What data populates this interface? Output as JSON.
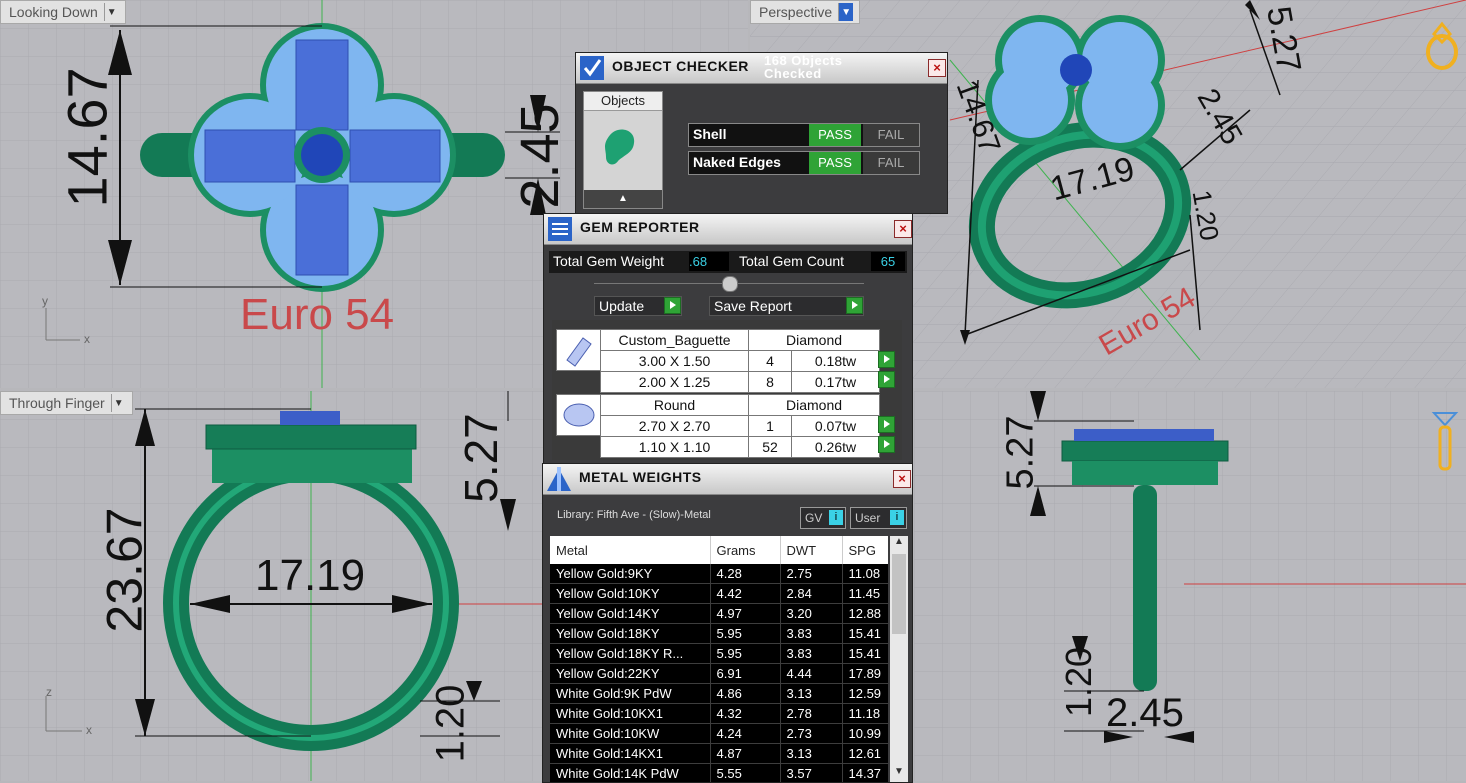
{
  "viewports": {
    "top": {
      "label": "Looking Down",
      "dims": [
        "14.67",
        "2.45"
      ],
      "size_label": "Euro 54",
      "axes": [
        "y",
        "x"
      ]
    },
    "perspective": {
      "label": "Perspective",
      "dims": [
        "5.27",
        "2.45",
        "14.67",
        "17.19",
        "1.20"
      ],
      "size_label": "Euro 54"
    },
    "front": {
      "label": "Through Finger",
      "dims": [
        "5.27",
        "23.67",
        "17.19",
        "1.20"
      ],
      "axes": [
        "z",
        "x"
      ]
    },
    "right": {
      "dims": [
        "5.27",
        "1.20",
        "2.45"
      ]
    }
  },
  "object_checker": {
    "title": "OBJECT CHECKER",
    "status": "168 Objects Checked",
    "objects_label": "Objects",
    "checks": [
      {
        "name": "Shell",
        "pass": "PASS",
        "fail": "FAIL"
      },
      {
        "name": "Naked Edges",
        "pass": "PASS",
        "fail": "FAIL"
      }
    ],
    "colors": {
      "pass": "#2fa336",
      "fail": "#3a3a3a"
    }
  },
  "gem_reporter": {
    "title": "GEM REPORTER",
    "total_weight_label": "Total Gem Weight",
    "total_weight": ".68",
    "total_count_label": "Total Gem Count",
    "total_count": "65",
    "update_label": "Update",
    "save_label": "Save Report",
    "groups": [
      {
        "shape": "Custom_Baguette",
        "material": "Diamond",
        "rows": [
          {
            "size": "3.00 X 1.50",
            "count": "4",
            "tw": "0.18tw"
          },
          {
            "size": "2.00 X 1.25",
            "count": "8",
            "tw": "0.17tw"
          }
        ]
      },
      {
        "shape": "Round",
        "material": "Diamond",
        "rows": [
          {
            "size": "2.70 X 2.70",
            "count": "1",
            "tw": "0.07tw"
          },
          {
            "size": "1.10 X 1.10",
            "count": "52",
            "tw": "0.26tw"
          }
        ]
      }
    ]
  },
  "metal_weights": {
    "title": "METAL WEIGHTS",
    "library": "Library: Fifth Ave - (Slow)-Metal",
    "gv_label": "GV",
    "user_label": "User",
    "columns": [
      "Metal",
      "Grams",
      "DWT",
      "SPG"
    ],
    "rows": [
      [
        "Yellow Gold:9KY",
        "4.28",
        "2.75",
        "11.08"
      ],
      [
        "Yellow Gold:10KY",
        "4.42",
        "2.84",
        "11.45"
      ],
      [
        "Yellow Gold:14KY",
        "4.97",
        "3.20",
        "12.88"
      ],
      [
        "Yellow Gold:18KY",
        "5.95",
        "3.83",
        "15.41"
      ],
      [
        "Yellow Gold:18KY R...",
        "5.95",
        "3.83",
        "15.41"
      ],
      [
        "Yellow Gold:22KY",
        "6.91",
        "4.44",
        "17.89"
      ],
      [
        "White Gold:9K PdW",
        "4.86",
        "3.13",
        "12.59"
      ],
      [
        "White Gold:10KX1",
        "4.32",
        "2.78",
        "11.18"
      ],
      [
        "White Gold:10KW",
        "4.24",
        "2.73",
        "10.99"
      ],
      [
        "White Gold:14KX1",
        "4.87",
        "3.13",
        "12.61"
      ],
      [
        "White Gold:14K PdW",
        "5.55",
        "3.57",
        "14.37"
      ]
    ]
  }
}
